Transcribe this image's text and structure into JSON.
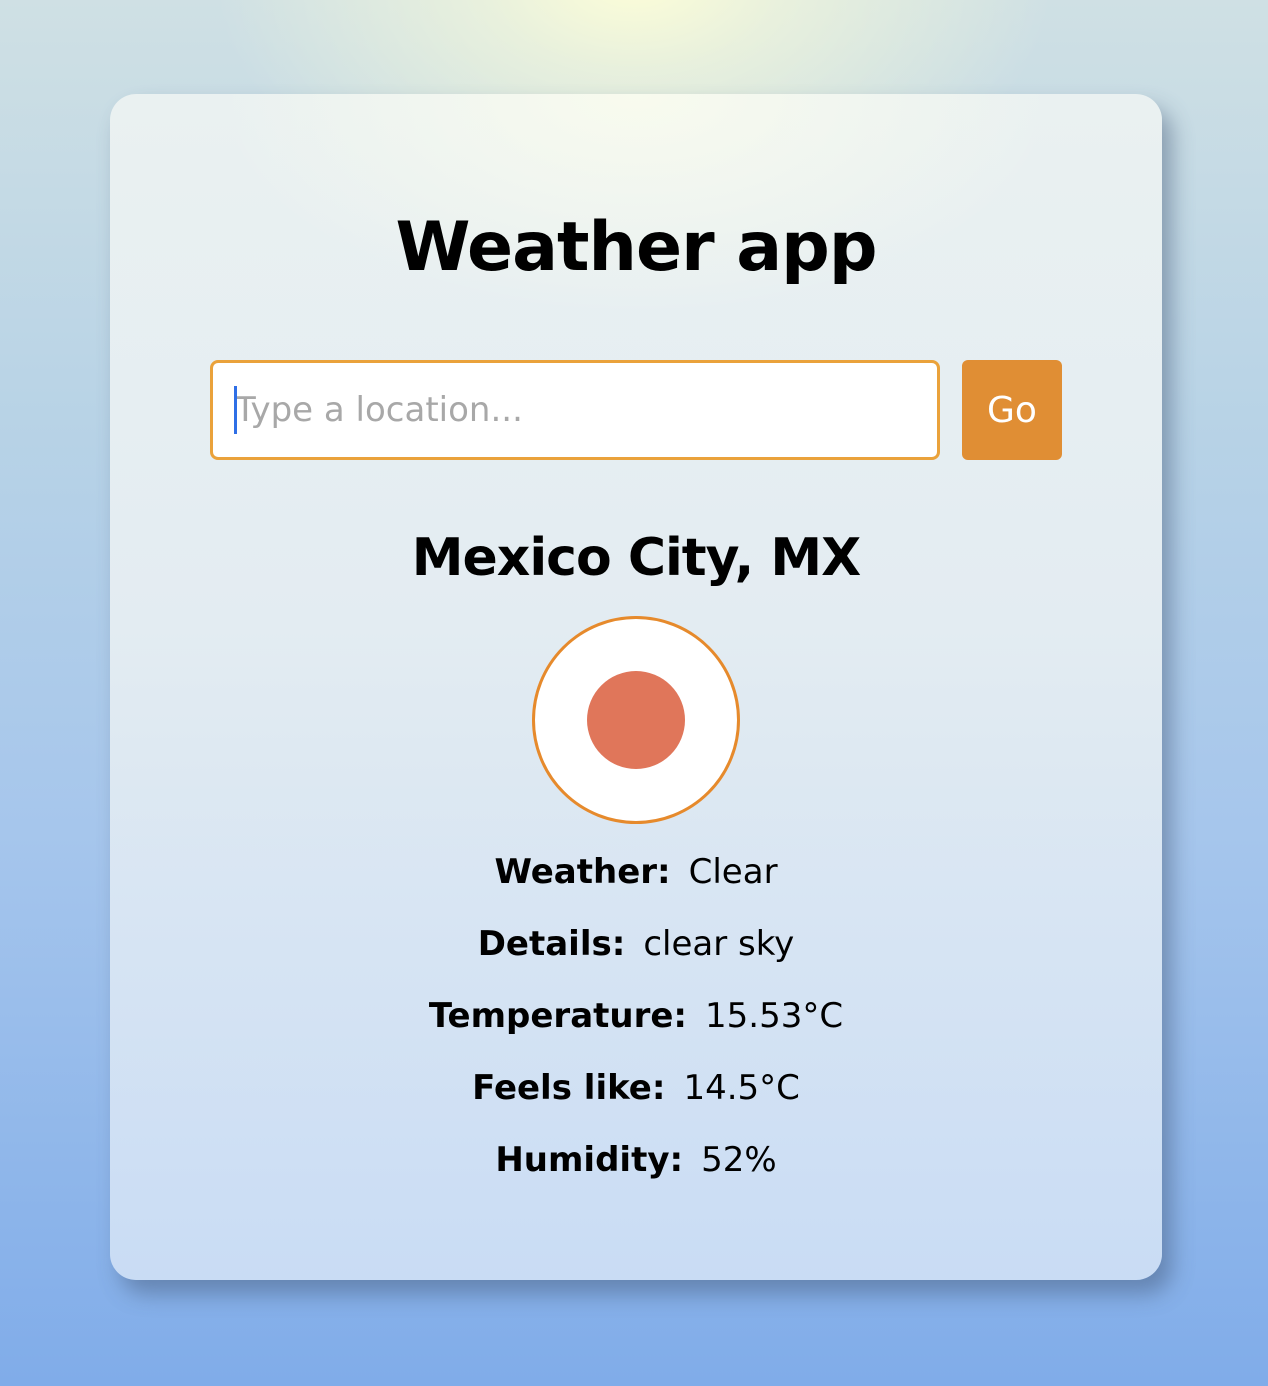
{
  "app": {
    "title": "Weather app"
  },
  "search": {
    "placeholder": "Type a location...",
    "value": "",
    "button_label": "Go"
  },
  "location": {
    "name": "Mexico City, MX"
  },
  "icon": {
    "name": "sun-icon",
    "ring_color": "#e68a2c",
    "fill_color": "#e0765a"
  },
  "details": [
    {
      "label": "Weather:",
      "value": "Clear"
    },
    {
      "label": "Details:",
      "value": "clear sky"
    },
    {
      "label": "Temperature:",
      "value": "15.53°C"
    },
    {
      "label": "Feels like:",
      "value": "14.5°C"
    },
    {
      "label": "Humidity:",
      "value": "52%"
    }
  ],
  "colors": {
    "accent": "#e08e34",
    "input_border": "#eaa23b"
  }
}
